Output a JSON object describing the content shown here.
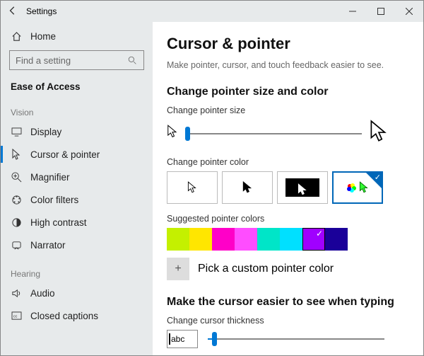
{
  "window": {
    "title": "Settings"
  },
  "sidebar": {
    "home": "Home",
    "search_placeholder": "Find a setting",
    "category": "Ease of Access",
    "groups": [
      {
        "label": "Vision",
        "items": [
          "Display",
          "Cursor & pointer",
          "Magnifier",
          "Color filters",
          "High contrast",
          "Narrator"
        ],
        "selected_index": 1
      },
      {
        "label": "Hearing",
        "items": [
          "Audio",
          "Closed captions"
        ]
      }
    ]
  },
  "main": {
    "title": "Cursor & pointer",
    "subtitle": "Make pointer, cursor, and touch feedback easier to see.",
    "section1_title": "Change pointer size and color",
    "pointer_size_label": "Change pointer size",
    "pointer_color_label": "Change pointer color",
    "suggested_label": "Suggested pointer colors",
    "custom_label": "Pick a custom pointer color",
    "section2_title": "Make the cursor easier to see when typing",
    "thickness_label": "Change cursor thickness",
    "abc_text": "abc",
    "suggested_colors": [
      "#c4f000",
      "#ffe600",
      "#ff00c8",
      "#ff4dff",
      "#00e5c8",
      "#00e0ff",
      "#a000ff",
      "#1a0099"
    ],
    "selected_color_index": 6
  }
}
